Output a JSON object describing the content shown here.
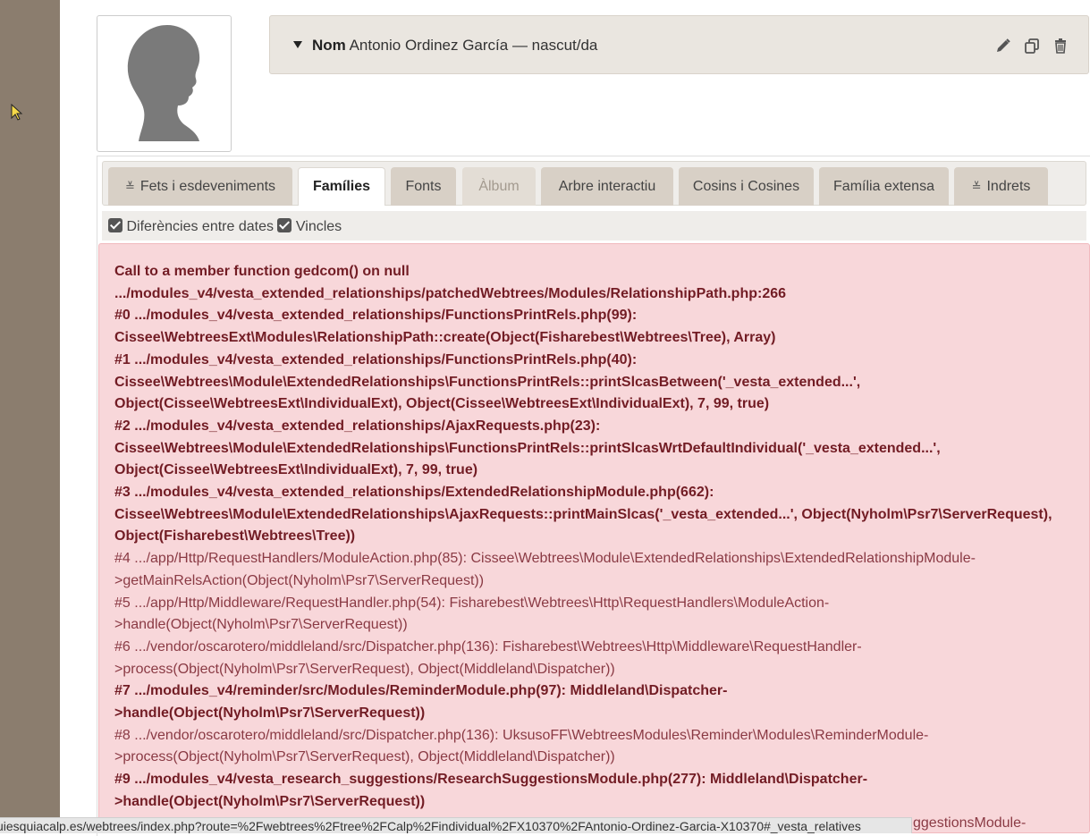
{
  "person": {
    "name_label": "Nom",
    "name_value": "Antonio Ordinez García — nascut/da"
  },
  "tabs": [
    {
      "label": "Fets i esdeveniments",
      "prefix": "≚",
      "state": "normal"
    },
    {
      "label": "Famílies",
      "prefix": "",
      "state": "active"
    },
    {
      "label": "Fonts",
      "prefix": "",
      "state": "normal"
    },
    {
      "label": "Àlbum",
      "prefix": "",
      "state": "disabled"
    },
    {
      "label": "Arbre interactiu",
      "prefix": "",
      "state": "normal"
    },
    {
      "label": "Cosins i Cosines",
      "prefix": "",
      "state": "normal"
    },
    {
      "label": "Família extensa",
      "prefix": "",
      "state": "normal"
    },
    {
      "label": "Indrets",
      "prefix": "≚",
      "state": "normal"
    }
  ],
  "options": {
    "date_diff_label": "Diferències entre dates",
    "links_label": "Vincles"
  },
  "error": {
    "lines": [
      "Call to a member function gedcom() on null",
      ".../modules_v4/vesta_extended_relationships/patchedWebtrees/Modules/RelationshipPath.php:266",
      "#0 .../modules_v4/vesta_extended_relationships/FunctionsPrintRels.php(99):",
      "Cissee\\WebtreesExt\\Modules\\RelationshipPath::create(Object(Fisharebest\\Webtrees\\Tree), Array)",
      "#1 .../modules_v4/vesta_extended_relationships/FunctionsPrintRels.php(40):",
      "Cissee\\Webtrees\\Module\\ExtendedRelationships\\FunctionsPrintRels::printSlcasBetween('_vesta_extended...',",
      "Object(Cissee\\WebtreesExt\\IndividualExt), Object(Cissee\\WebtreesExt\\IndividualExt), 7, 99, true)",
      "#2 .../modules_v4/vesta_extended_relationships/AjaxRequests.php(23):",
      "Cissee\\Webtrees\\Module\\ExtendedRelationships\\FunctionsPrintRels::printSlcasWrtDefaultIndividual('_vesta_extended...',",
      "Object(Cissee\\WebtreesExt\\IndividualExt), 7, 99, true)",
      "#3 .../modules_v4/vesta_extended_relationships/ExtendedRelationshipModule.php(662):",
      "Cissee\\Webtrees\\Module\\ExtendedRelationships\\AjaxRequests::printMainSlcas('_vesta_extended...', Object(Nyholm\\Psr7\\ServerRequest),",
      "Object(Fisharebest\\Webtrees\\Tree))",
      "#4 .../app/Http/RequestHandlers/ModuleAction.php(85): Cissee\\Webtrees\\Module\\ExtendedRelationships\\ExtendedRelationshipModule-",
      ">getMainRelsAction(Object(Nyholm\\Psr7\\ServerRequest))",
      "#5 .../app/Http/Middleware/RequestHandler.php(54): Fisharebest\\Webtrees\\Http\\RequestHandlers\\ModuleAction-",
      ">handle(Object(Nyholm\\Psr7\\ServerRequest))",
      "#6 .../vendor/oscarotero/middleland/src/Dispatcher.php(136): Fisharebest\\Webtrees\\Http\\Middleware\\RequestHandler-",
      ">process(Object(Nyholm\\Psr7\\ServerRequest), Object(Middleland\\Dispatcher))",
      "#7 .../modules_v4/reminder/src/Modules/ReminderModule.php(97): Middleland\\Dispatcher-",
      ">handle(Object(Nyholm\\Psr7\\ServerRequest))",
      "#8 .../vendor/oscarotero/middleland/src/Dispatcher.php(136): UksusoFF\\WebtreesModules\\Reminder\\Modules\\ReminderModule-",
      ">process(Object(Nyholm\\Psr7\\ServerRequest), Object(Middleland\\Dispatcher))",
      "#9 .../modules_v4/vesta_research_suggestions/ResearchSuggestionsModule.php(277): Middleland\\Dispatcher-",
      ">handle(Object(Nyholm\\Psr7\\ServerRequest))"
    ],
    "tail_fragment": "ggestionsModule-"
  },
  "status_url": "uiesquiacalp.es/webtrees/index.php?route=%2Fwebtrees%2Ftree%2FCalp%2Findividual%2FX10370%2FAntonio-Ordinez-Garcia-X10370#_vesta_relatives",
  "colors": {
    "sidebar": "#8b7d6e",
    "error_bg": "#f8d7da",
    "error_text": "#721c24"
  }
}
